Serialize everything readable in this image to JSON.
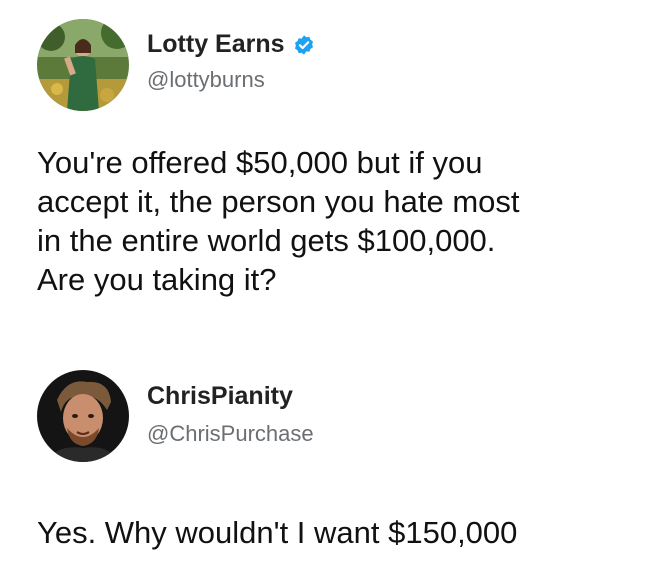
{
  "tweets": [
    {
      "display_name": "Lotty Earns",
      "handle": "@lottyburns",
      "verified": true,
      "text_lines": [
        "You're offered $50,000 but if you",
        "accept it, the person you hate most",
        "in the entire world gets $100,000.",
        "Are you taking it?"
      ]
    },
    {
      "display_name": "ChrisPianity",
      "handle": "@ChrisPurchase",
      "verified": false,
      "text_lines": [
        "Yes. Why wouldn't I want $150,000"
      ]
    }
  ],
  "icons": {
    "verified": "verified-badge-icon"
  },
  "colors": {
    "verified_blue": "#1da1f2",
    "handle_gray": "#6b6f73"
  }
}
